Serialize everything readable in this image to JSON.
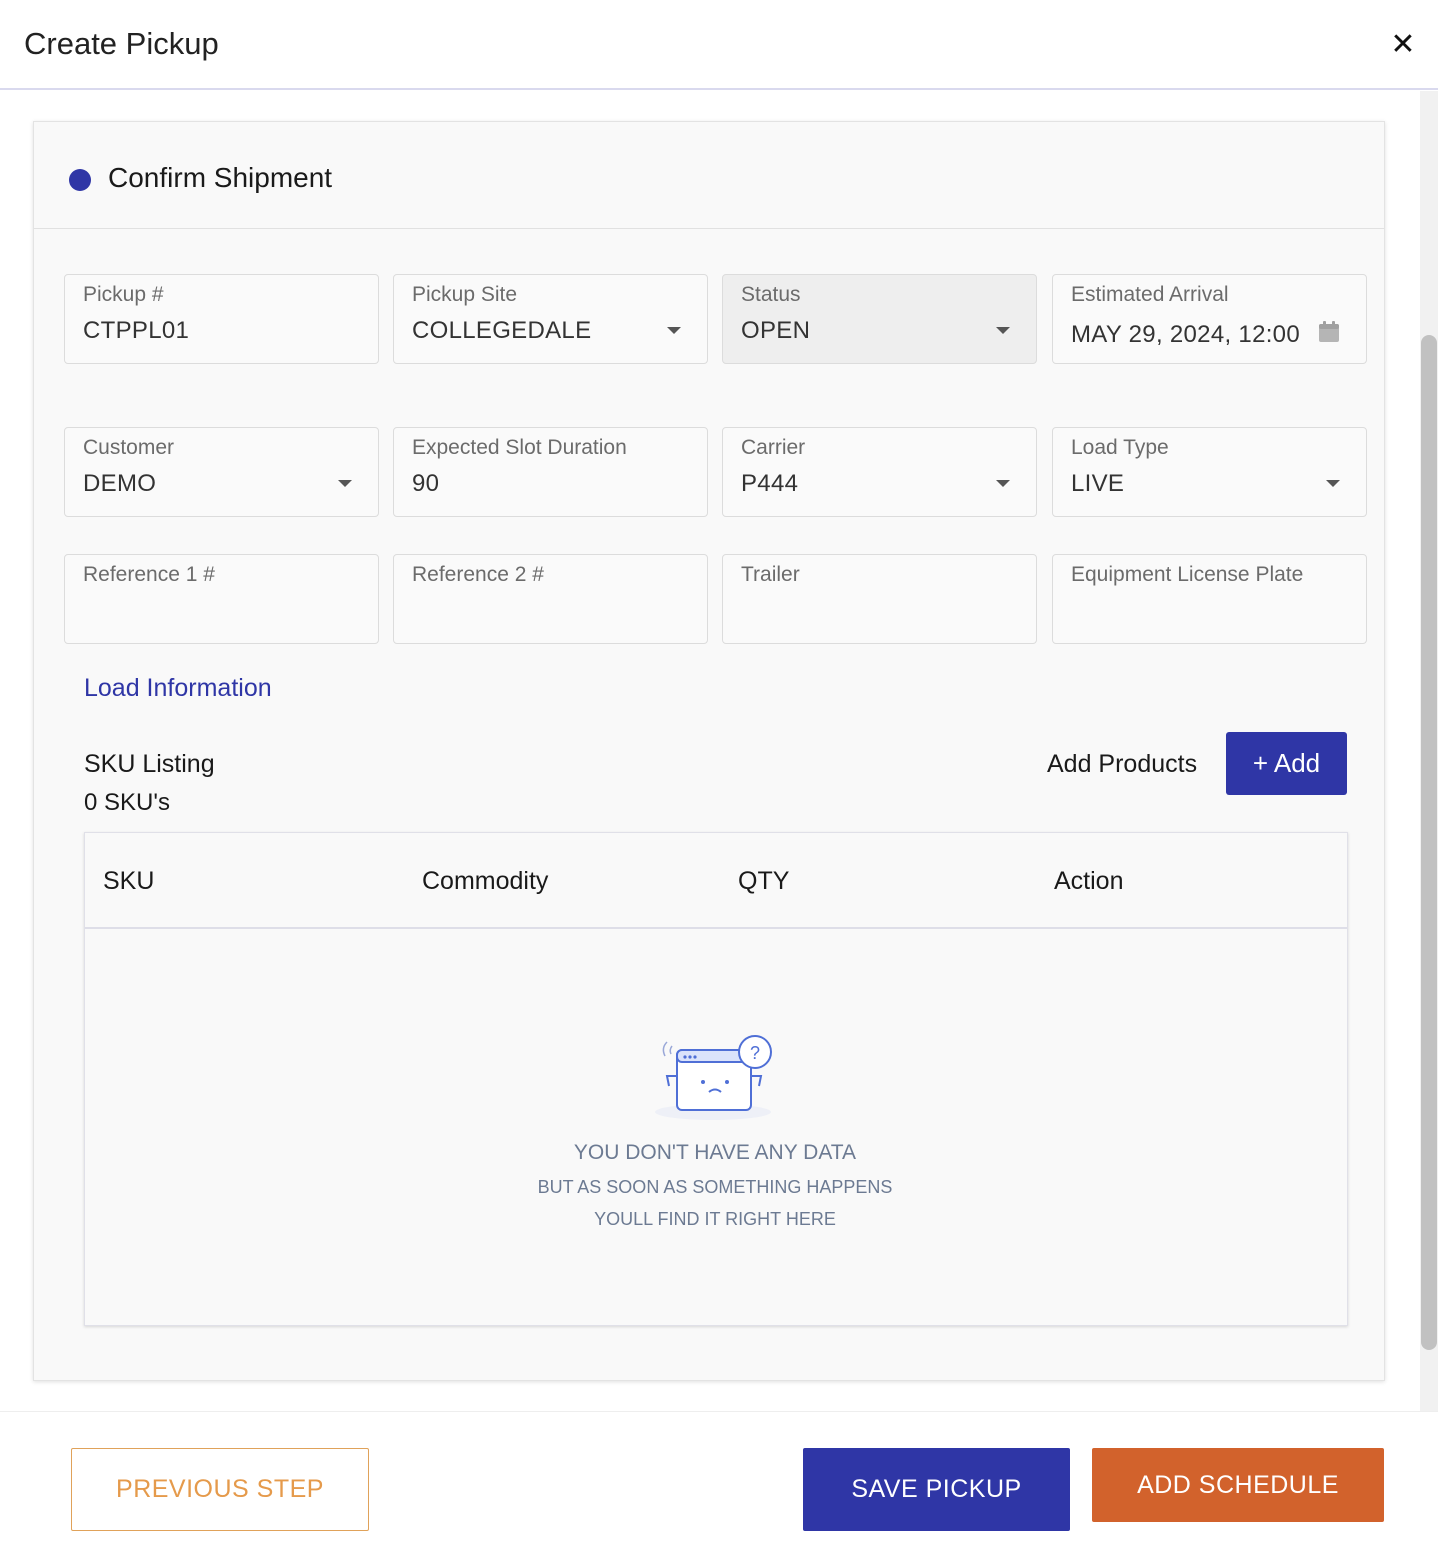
{
  "dialog": {
    "title": "Create Pickup",
    "close_glyph": "✕"
  },
  "section": {
    "title": "Confirm Shipment",
    "accent": "#2f36a6"
  },
  "fields": {
    "pickup_no": {
      "label": "Pickup #",
      "value": "CTPPL01"
    },
    "pickup_site": {
      "label": "Pickup Site",
      "value": "COLLEGEDALE"
    },
    "status": {
      "label": "Status",
      "value": "OPEN"
    },
    "estimated_arrival": {
      "label": "Estimated Arrival",
      "value": "MAY 29, 2024, 12:00",
      "icon": "calendar-icon"
    },
    "customer": {
      "label": "Customer",
      "value": "DEMO"
    },
    "expected_slot_duration": {
      "label": "Expected Slot Duration",
      "value": "90"
    },
    "carrier": {
      "label": "Carrier",
      "value": "P444"
    },
    "load_type": {
      "label": "Load Type",
      "value": "LIVE"
    },
    "reference1": {
      "label": "Reference 1 #",
      "value": ""
    },
    "reference2": {
      "label": "Reference 2 #",
      "value": ""
    },
    "trailer": {
      "label": "Trailer",
      "value": ""
    },
    "equipment_license_plate": {
      "label": "Equipment License Plate",
      "value": ""
    }
  },
  "load_info": {
    "link_label": "Load Information"
  },
  "sku": {
    "title": "SKU Listing",
    "count": "0 SKU's",
    "add_products_label": "Add Products",
    "add_button": "+ Add",
    "columns": [
      "SKU",
      "Commodity",
      "QTY",
      "Action"
    ],
    "empty": {
      "line1": "YOU DON'T HAVE ANY DATA",
      "line2": "BUT AS SOON AS SOMETHING HAPPENS",
      "line3": "YOULL FIND IT RIGHT HERE"
    }
  },
  "footer": {
    "previous": "PREVIOUS STEP",
    "save": "SAVE PICKUP",
    "schedule": "ADD SCHEDULE"
  },
  "colors": {
    "primary": "#2f36a6",
    "orange": "#d2622c",
    "outline_orange": "#e59a4b"
  }
}
